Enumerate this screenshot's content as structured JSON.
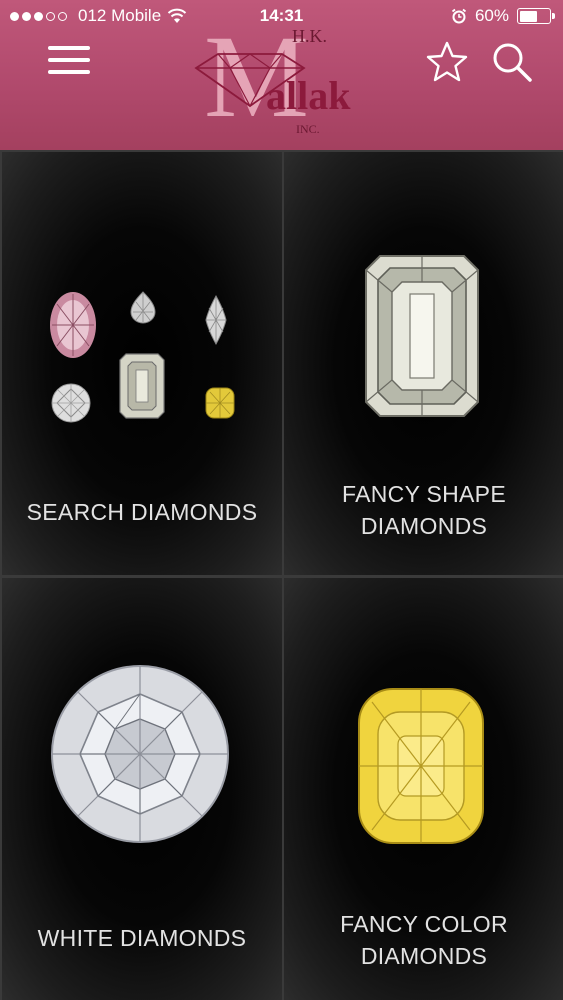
{
  "status_bar": {
    "carrier": "012 Mobile",
    "time": "14:31",
    "battery": "60%",
    "battery_level": 0.6
  },
  "header": {
    "logo": {
      "prefix": "H.K.",
      "name": "allak",
      "initial": "M",
      "suffix": "INC."
    }
  },
  "tiles": [
    {
      "label": "SEARCH DIAMONDS"
    },
    {
      "label_line1": "FANCY SHAPE",
      "label_line2": "DIAMONDS"
    },
    {
      "label": "WHITE DIAMONDS"
    },
    {
      "label_line1": "FANCY COLOR",
      "label_line2": "DIAMONDS"
    }
  ],
  "colors": {
    "header": "#b14a6d",
    "logo_text": "#8c1a3c",
    "tile_label": "#e2e2e2"
  }
}
